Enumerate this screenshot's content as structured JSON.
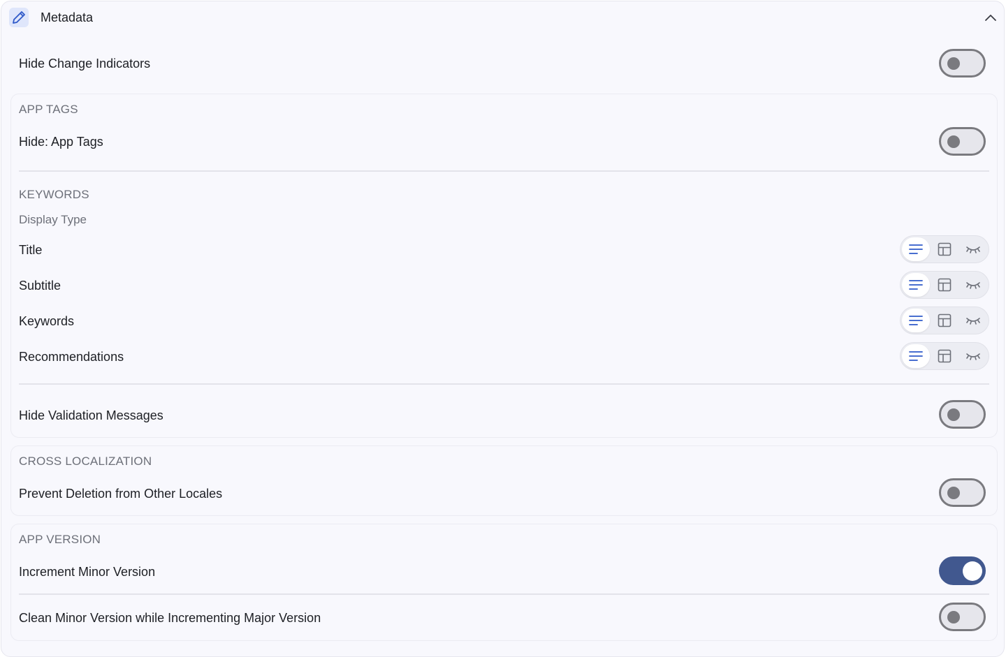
{
  "header": {
    "title": "Metadata",
    "icon": "pencil-icon",
    "collapse_icon": "chevron-up-icon"
  },
  "hide_change_indicators": {
    "label": "Hide Change Indicators",
    "enabled": false
  },
  "app_tags": {
    "section_title": "APP TAGS",
    "hide_app_tags": {
      "label": "Hide: App Tags",
      "enabled": false
    }
  },
  "keywords": {
    "section_title": "KEYWORDS",
    "display_type_label": "Display Type",
    "display_options": [
      "lines-icon",
      "grid-icon",
      "eye-closed-icon"
    ],
    "rows": [
      {
        "label": "Title",
        "selected": "lines-icon"
      },
      {
        "label": "Subtitle",
        "selected": "lines-icon"
      },
      {
        "label": "Keywords",
        "selected": "lines-icon"
      },
      {
        "label": "Recommendations",
        "selected": "lines-icon"
      }
    ]
  },
  "hide_validation_messages": {
    "label": "Hide Validation Messages",
    "enabled": false
  },
  "cross_localization": {
    "section_title": "CROSS LOCALIZATION",
    "prevent_deletion": {
      "label": "Prevent Deletion from Other Locales",
      "enabled": false
    }
  },
  "app_version": {
    "section_title": "APP VERSION",
    "increment_minor": {
      "label": "Increment Minor Version",
      "enabled": true
    },
    "clean_minor": {
      "label": "Clean Minor Version while Incrementing Major Version",
      "enabled": false
    }
  },
  "colors": {
    "accent": "#41588f",
    "toggle_off_border": "#7a7a7f",
    "icon_blue": "#2f59c9",
    "panel_bg": "#f8f8fd"
  }
}
